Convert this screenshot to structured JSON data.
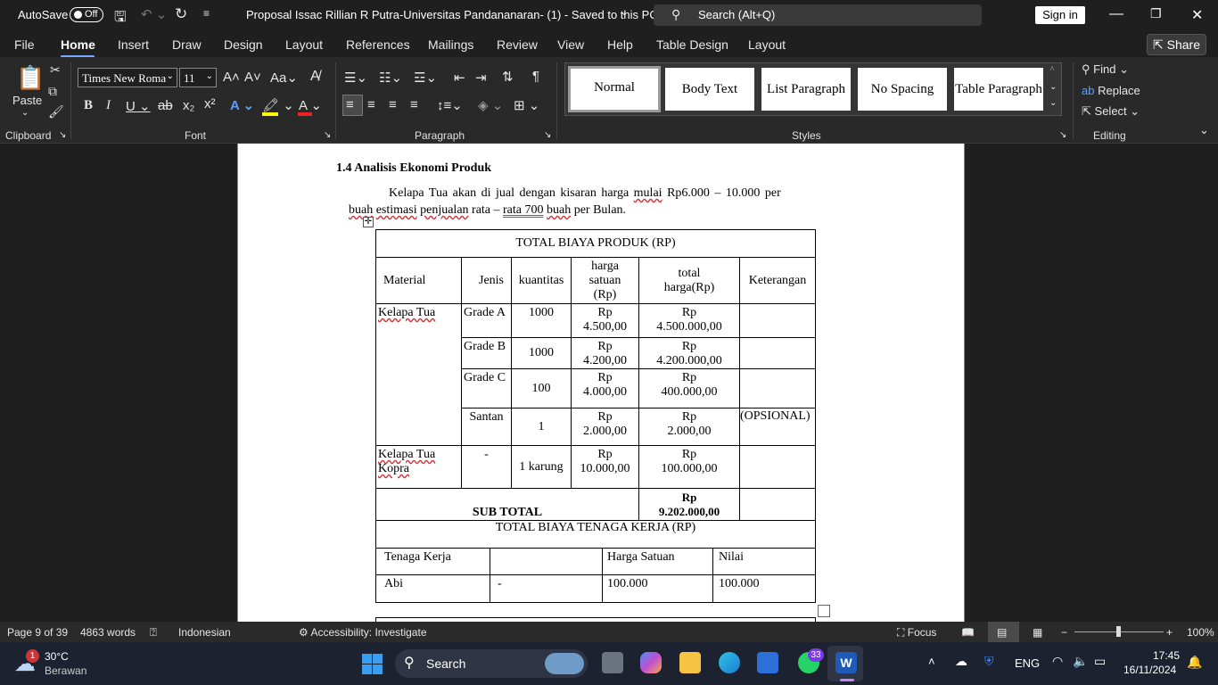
{
  "titlebar": {
    "autosave_label": "AutoSave",
    "autosave_state": "Off",
    "doc_title": "Proposal Issac Rillian R Putra-Universitas Pandananaran- (1)  -  Saved to this PC",
    "search_placeholder": "Search (Alt+Q)",
    "signin_label": "Sign in"
  },
  "tabs": [
    "File",
    "Home",
    "Insert",
    "Draw",
    "Design",
    "Layout",
    "References",
    "Mailings",
    "Review",
    "View",
    "Help",
    "Table Design",
    "Layout"
  ],
  "share_label": "Share",
  "ribbon": {
    "clipboard": {
      "paste_label": "Paste",
      "group_label": "Clipboard"
    },
    "font": {
      "font_name": "Times New Roma",
      "font_size": "11",
      "group_label": "Font"
    },
    "paragraph": {
      "group_label": "Paragraph"
    },
    "styles": {
      "group_label": "Styles",
      "items": [
        "Normal",
        "Body Text",
        "List Paragraph",
        "No Spacing",
        "Table Paragraph"
      ]
    },
    "editing": {
      "group_label": "Editing",
      "find_label": "Find",
      "replace_label": "Replace",
      "select_label": "Select"
    }
  },
  "document": {
    "heading": "1.4 Analisis Ekonomi Produk",
    "para_line1": {
      "pre": "Kelapa Tua akan di jual dengan kisaran harga ",
      "mulai": "mulai",
      "post": " Rp6.000 – 10.000 per"
    },
    "para_line2": {
      "buah": "buah",
      "estimasi": "estimasi",
      "penjualan": "penjualan",
      "rata_pre": " rata – ",
      "rata": "rata",
      "seven": "  700",
      "buah2": "buah",
      "post": " per Bulan."
    },
    "table1_title": "TOTAL BIAYA PRODUK (RP)",
    "headers": {
      "material": "Material",
      "jenis": "Jenis",
      "kuantitas": "kuantitas",
      "harga_satuan": "harga satuan (Rp)",
      "total_harga": "total harga(Rp)",
      "keterangan": "Keterangan"
    },
    "rows": [
      {
        "material": "Kelapa Tua",
        "jenis": "Grade A",
        "kuantitas": "1000",
        "harga_1": "Rp",
        "harga_2": "4.500,00",
        "total_1": "Rp",
        "total_2": "4.500.000,00",
        "ket": ""
      },
      {
        "material": "",
        "jenis": "Grade B",
        "kuantitas": "1000",
        "harga_1": "Rp",
        "harga_2": "4.200,00",
        "total_1": "Rp",
        "total_2": "4.200.000,00",
        "ket": ""
      },
      {
        "material": "",
        "jenis": "Grade C",
        "kuantitas": "100",
        "harga_1": "Rp",
        "harga_2": "4.000,00",
        "total_1": "Rp",
        "total_2": "400.000,00",
        "ket": ""
      },
      {
        "material": "",
        "jenis": "Santan",
        "kuantitas": "1",
        "harga_1": "Rp",
        "harga_2": "2.000,00",
        "total_1": "Rp",
        "total_2": "2.000,00",
        "ket": "(OPSIONAL)"
      },
      {
        "material": "Kelapa Tua Kopra",
        "jenis": "-",
        "kuantitas": "1 karung",
        "harga_1": "Rp",
        "harga_2": "10.000,00",
        "total_1": "Rp",
        "total_2": "100.000,00",
        "ket": ""
      }
    ],
    "subtotal_label": "SUB TOTAL",
    "subtotal_1": "Rp",
    "subtotal_2": "9.202.000,00",
    "table2_title": "TOTAL BIAYA TENAGA KERJA (RP)",
    "t2_headers": {
      "tenaga": "Tenaga Kerja",
      "blank": "",
      "harga": "Harga Satuan",
      "nilai": "Nilai"
    },
    "t2_row": {
      "tenaga": "Abi",
      "blank": "-",
      "harga": "100.000",
      "nilai": "100.000"
    }
  },
  "statusbar": {
    "page": "Page 9 of 39",
    "words": "4863 words",
    "language": "Indonesian",
    "accessibility": "Accessibility: Investigate",
    "focus": "Focus",
    "zoom": "100%",
    "zoom_fraction": 0.5
  },
  "taskbar": {
    "weather_temp": "30°C",
    "weather_desc": "Berawan",
    "weather_badge": "1",
    "search_label": "Search",
    "whatsapp_badge": "33",
    "lang": "ENG",
    "time": "17:45",
    "date": "16/11/2024"
  }
}
